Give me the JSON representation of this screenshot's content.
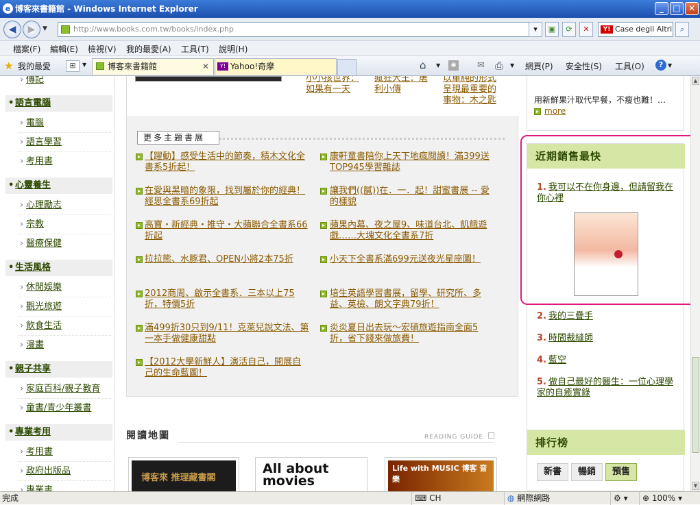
{
  "window": {
    "title": "博客來書籍館 - Windows Internet Explorer",
    "min": "_",
    "max": "□",
    "close": "✕"
  },
  "address": {
    "url": "http://www.books.com.tw/books/index.php",
    "search_text": "Case degli Altri"
  },
  "menu": [
    "檔案(F)",
    "編輯(E)",
    "檢視(V)",
    "我的最愛(A)",
    "工具(T)",
    "說明(H)"
  ],
  "tabs": {
    "favorites": "我的最愛",
    "active": "博客來書籍館",
    "second": "Yahoo!奇摩"
  },
  "toolbar": {
    "page": "網頁(P)",
    "safety": "安全性(S)",
    "tools": "工具(O)"
  },
  "leftnav": {
    "top_item": "傳記",
    "groups": [
      {
        "title": "語言電腦",
        "items": [
          "電腦",
          "語言學習",
          "考用書"
        ]
      },
      {
        "title": "心靈養生",
        "items": [
          "心理勵志",
          "宗教",
          "醫療保健"
        ]
      },
      {
        "title": "生活風格",
        "items": [
          "休閒娛樂",
          "觀光旅遊",
          "飲食生活",
          "漫畫"
        ]
      },
      {
        "title": "親子共享",
        "items": [
          "家庭百科/親子教育",
          "童書/青少年叢書"
        ]
      },
      {
        "title": "專業考用",
        "items": [
          "考用書",
          "政府出版品",
          "專業書"
        ]
      }
    ]
  },
  "top_books": [
    {
      "title": "小小孩世界：如果有一天",
      "lines": [
        "小小孩世界：",
        "如果有一天"
      ]
    },
    {
      "title": "瘋狂大王：屠利小傳",
      "lines": [
        "瘋狂大王：屠",
        "利小傳"
      ]
    },
    {
      "title": "以單純的形式呈現最重要的事物：木之匙",
      "lines": [
        "以單純的形式",
        "呈現最重要的",
        "事物：木之匙"
      ]
    }
  ],
  "themes": {
    "title": "更多主題書展",
    "items": [
      {
        "text": "【躍動】感受生活中的節奏，積木文化全書系5折起！",
        "lines": [
          "【躍動】感受生活中的節奏，積木文化全",
          "書系5折起！"
        ]
      },
      {
        "text": "康軒童書陪你上天下地瘋閱讀！滿399送TOP945學習雜誌",
        "lines": [
          "康軒童書陪你上天下地瘋閱讀！滿399送",
          "TOP945學習雜誌"
        ]
      },
      {
        "text": "在愛與黑暗的象限，找到屬於你的經典！經思全書系69折起",
        "lines": [
          "在愛與黑暗的象限，找到屬於你的經典！",
          "經思全書系69折起"
        ]
      },
      {
        "text": "讓我們((膩))在．一．起！甜蜜書展 -- 愛的樣貌",
        "lines": [
          "讓我們((膩))在．一．起！甜蜜書展 -- 愛",
          "的樣貌"
        ]
      },
      {
        "text": "高寶・新經典・推守・大蘋聯合全書系66折起",
        "lines": [
          "高寶・新經典・推守・大蘋聯合全書系66",
          "折起"
        ]
      },
      {
        "text": "蘋果內幕、夜之屋9、味道台北、飢餓遊戲……大塊文化全書系7折",
        "lines": [
          "蘋果內幕、夜之屋9、味道台北、飢餓遊",
          "戲……大塊文化全書系7折"
        ]
      },
      {
        "text": "拉拉熊、水豚君、OPEN小將2本75折",
        "lines": [
          "拉拉熊、水豚君、OPEN小將2本75折"
        ]
      },
      {
        "text": "小天下全書系滿699元送夜光星座圖！",
        "lines": [
          "小天下全書系滿699元送夜光星座圖！"
        ]
      },
      {
        "text": "2012商周、啟示全書系．三本以上75折，特價5折",
        "lines": [
          "2012商周、啟示全書系．三本以上75",
          "折，特價5折"
        ]
      },
      {
        "text": "培生英語學習書展，留學、研究所、多益、英檢、朗文字典79折！",
        "lines": [
          "培生英語學習書展，留學、研究所、多",
          "益、英檢、朗文字典79折！"
        ]
      },
      {
        "text": "滿499折30只到9/11！克萊兒說文法、第一本手做健康甜點",
        "lines": [
          "滿499折30只到9/11！克萊兒說文法、第",
          "一本手做健康甜點"
        ]
      },
      {
        "text": "炎炎夏日出去玩～宏碩旅遊指南全面5折，省下錢來做旅費！",
        "lines": [
          "炎炎夏日出去玩～宏碩旅遊指南全面5",
          "折，省下錢來做旅費！"
        ]
      },
      {
        "text": "【2012大學新鮮人】演活自己，開展自己的生命藍圖！",
        "lines": [
          "【2012大學新鮮人】演活自己，開展自",
          "己的生命藍圖！"
        ]
      }
    ]
  },
  "reading_map": {
    "title": "閱讀地圖",
    "subtitle": "READING GUIDE",
    "thumbs": [
      "博客來 推理藏書閣",
      "All about movies",
      "Life with MUSIC 博客 音樂"
    ]
  },
  "right": {
    "promo_text": "用新鮮果汁取代早餐，不瘦也難！…",
    "promo_more": "more",
    "bestseller_title": "近期銷售最快",
    "ranks": [
      {
        "n": "1.",
        "lines": [
          "我可以不在你身邊，但請留我在",
          "你心裡"
        ]
      },
      {
        "n": "2.",
        "lines": [
          "我的三疊手"
        ]
      },
      {
        "n": "3.",
        "lines": [
          "時間裁縫師"
        ]
      },
      {
        "n": "4.",
        "lines": [
          "藍空"
        ]
      },
      {
        "n": "5.",
        "lines": [
          "做自己最好的醫生：一位心理學",
          "家的自癒實錄"
        ]
      }
    ],
    "rank_board_title": "排行榜",
    "rank_tabs": [
      "新書",
      "暢銷",
      "預售"
    ]
  },
  "status": {
    "left": "完成",
    "ime": "CH",
    "zone": "網際網路",
    "zoom": "100%"
  },
  "colors": {
    "highlight_border": "#e0177f",
    "header_bg": "#d6e6a5",
    "link_green": "#2d4a00",
    "link_orange": "#8a5a00"
  }
}
